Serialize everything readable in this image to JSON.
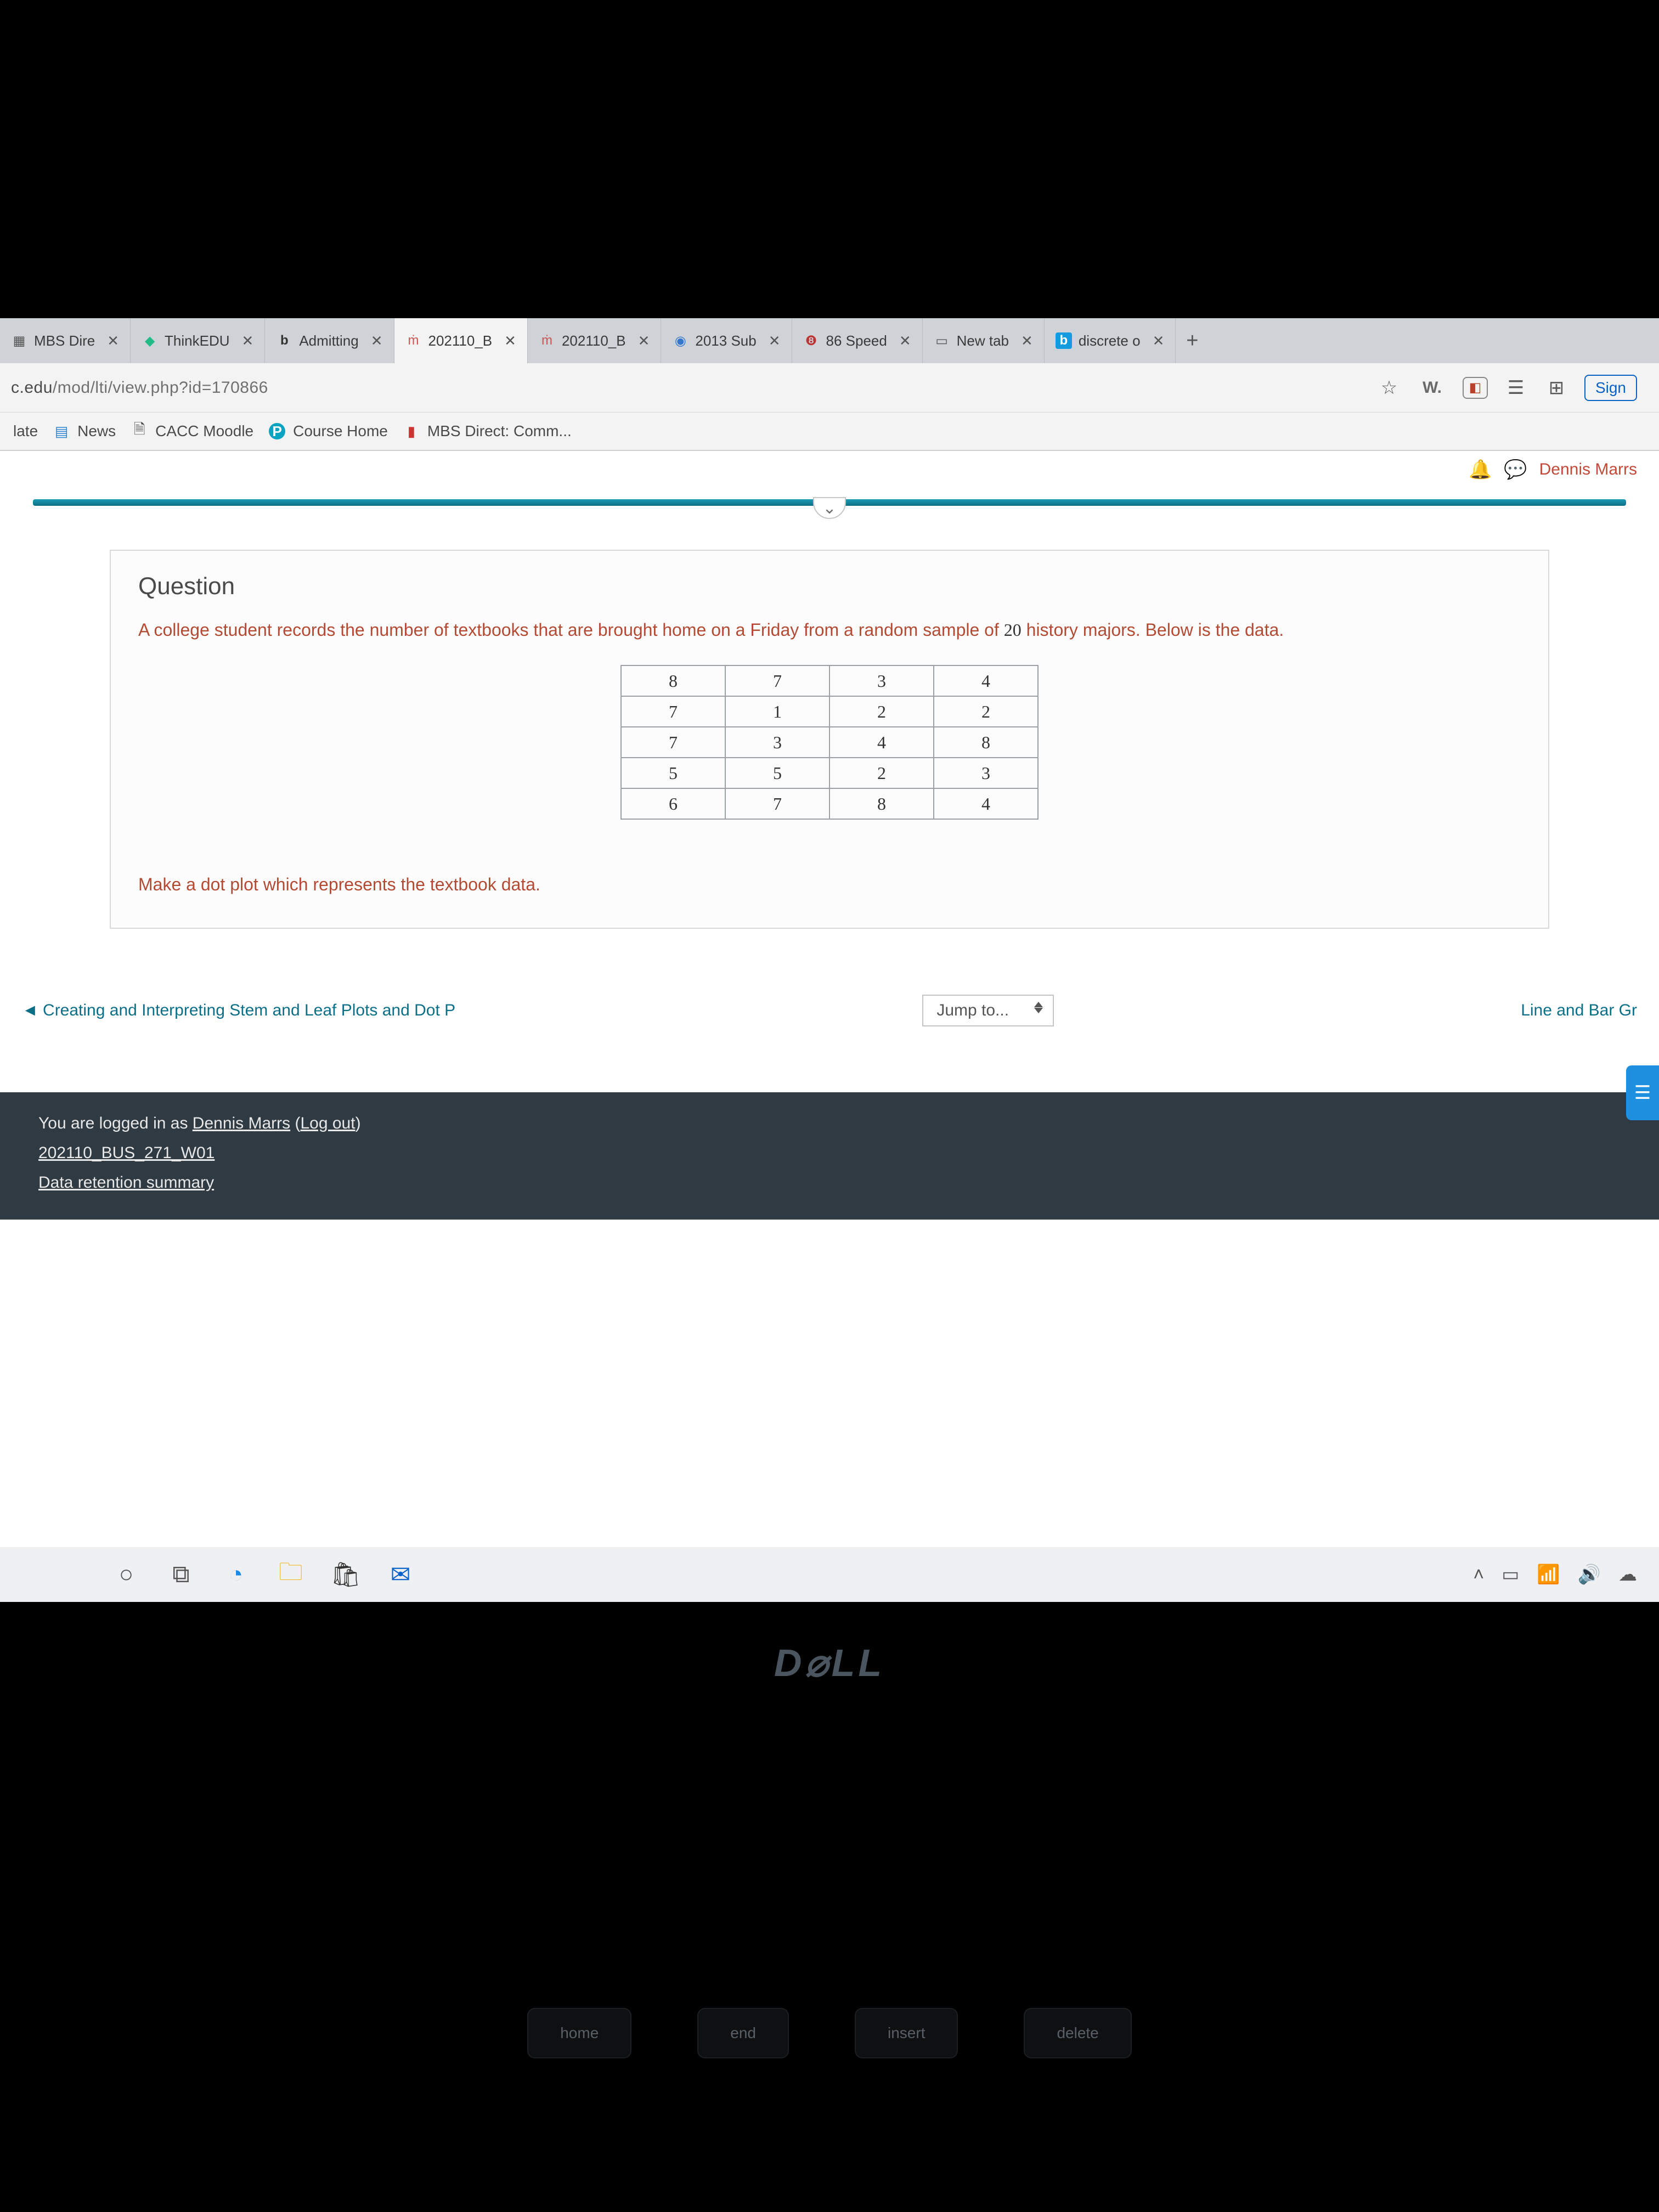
{
  "tabs": [
    {
      "label": "MBS Dire"
    },
    {
      "label": "ThinkEDU"
    },
    {
      "label": "Admitting"
    },
    {
      "label": "202110_B",
      "active": true
    },
    {
      "label": "202110_B"
    },
    {
      "label": "2013 Sub"
    },
    {
      "label": "86 Speed"
    },
    {
      "label": "New tab"
    },
    {
      "label": "discrete o"
    }
  ],
  "toolbar": {
    "url_host": "c.edu",
    "url_path": "/mod/lti/view.php?id=170866",
    "w": "W.",
    "sign": "Sign"
  },
  "favorites": [
    {
      "label": "late"
    },
    {
      "label": "News"
    },
    {
      "label": "CACC Moodle"
    },
    {
      "label": "Course Home"
    },
    {
      "label": "MBS Direct: Comm..."
    }
  ],
  "header": {
    "username": "Dennis Marrs"
  },
  "question": {
    "title": "Question",
    "prompt_pre": "A college student records the number of textbooks that are brought home on a Friday from a random sample of ",
    "prompt_num": "20",
    "prompt_post": " history majors. Below is the data.",
    "instruction": "Make a dot plot which represents the textbook data."
  },
  "chart_data": {
    "type": "table",
    "rows": [
      [
        "8",
        "7",
        "3",
        "4"
      ],
      [
        "7",
        "1",
        "2",
        "2"
      ],
      [
        "7",
        "3",
        "4",
        "8"
      ],
      [
        "5",
        "5",
        "2",
        "3"
      ],
      [
        "6",
        "7",
        "8",
        "4"
      ]
    ]
  },
  "nav": {
    "prev": "◄ Creating and Interpreting Stem and Leaf Plots and Dot P",
    "jump": "Jump to...",
    "next": "Line and Bar Gr"
  },
  "footer": {
    "logged_pre": "You are logged in as ",
    "logged_user": "Dennis Marrs",
    "logged_post": " (",
    "logout": "Log out",
    "close": ")",
    "course": "202110_BUS_271_W01",
    "retention": "Data retention summary"
  },
  "keyboard": {
    "k1": "home",
    "k2": "end",
    "k3": "insert",
    "k4": "delete"
  }
}
